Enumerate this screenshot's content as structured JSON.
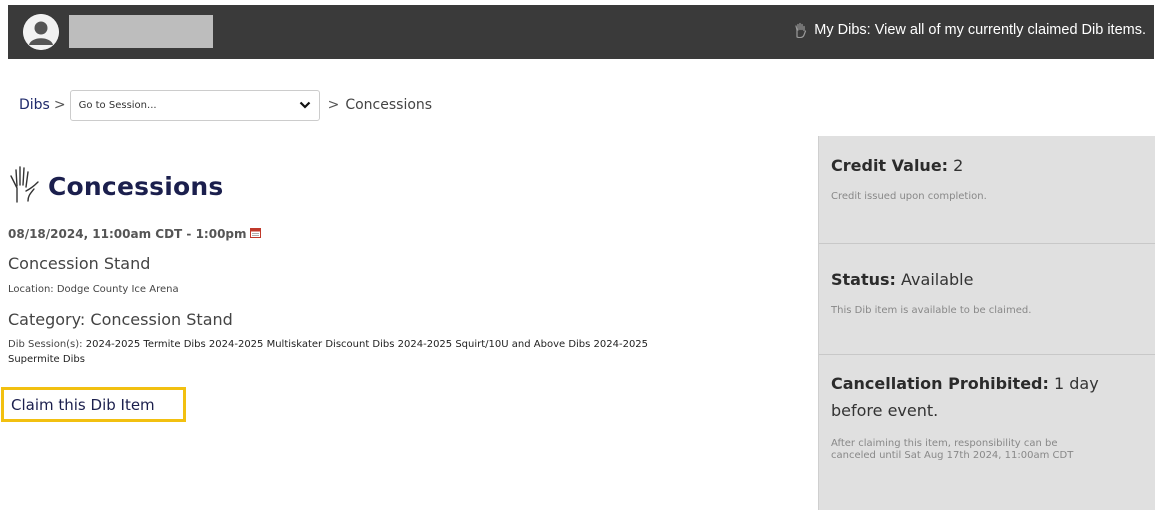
{
  "header": {
    "mydibs_label": "My Dibs: View all of my currently claimed Dib items.",
    "bar_color": "#3a3a3a"
  },
  "breadcrumb": {
    "root": "Dibs",
    "separator": ">",
    "session_select_value": "Go to Session...",
    "current": "Concessions"
  },
  "item": {
    "title": "Concessions",
    "datetime": "08/18/2024, 11:00am CDT - 1:00pm",
    "location_name": "Concession Stand",
    "location_label": "Location: Dodge County Ice Arena",
    "category": "Category: Concession Stand",
    "sessions_label": "Dib Session(s):",
    "sessions_value": "2024-2025 Termite Dibs 2024-2025 Multiskater Discount Dibs 2024-2025 Squirt/10U and Above Dibs 2024-2025 Supermite Dibs",
    "claim_label": "Claim this Dib Item",
    "highlight_color": "#f2c010"
  },
  "sidebar": {
    "credit": {
      "label": "Credit Value:",
      "value": "2",
      "note": "Credit issued upon completion."
    },
    "status": {
      "label": "Status:",
      "value": "Available",
      "note": "This Dib item is available to be claimed."
    },
    "cancellation": {
      "label": "Cancellation Prohibited:",
      "value": "1 day before event.",
      "note": "After claiming this item, responsibility can be canceled until Sat Aug 17th 2024, 11:00am CDT"
    }
  },
  "icons": {
    "avatar": "user-avatar-icon",
    "mydibs": "raised-hand-icon",
    "title": "raised-hand-icon",
    "calendar": "calendar-icon",
    "dropdown": "chevron-down-icon"
  }
}
